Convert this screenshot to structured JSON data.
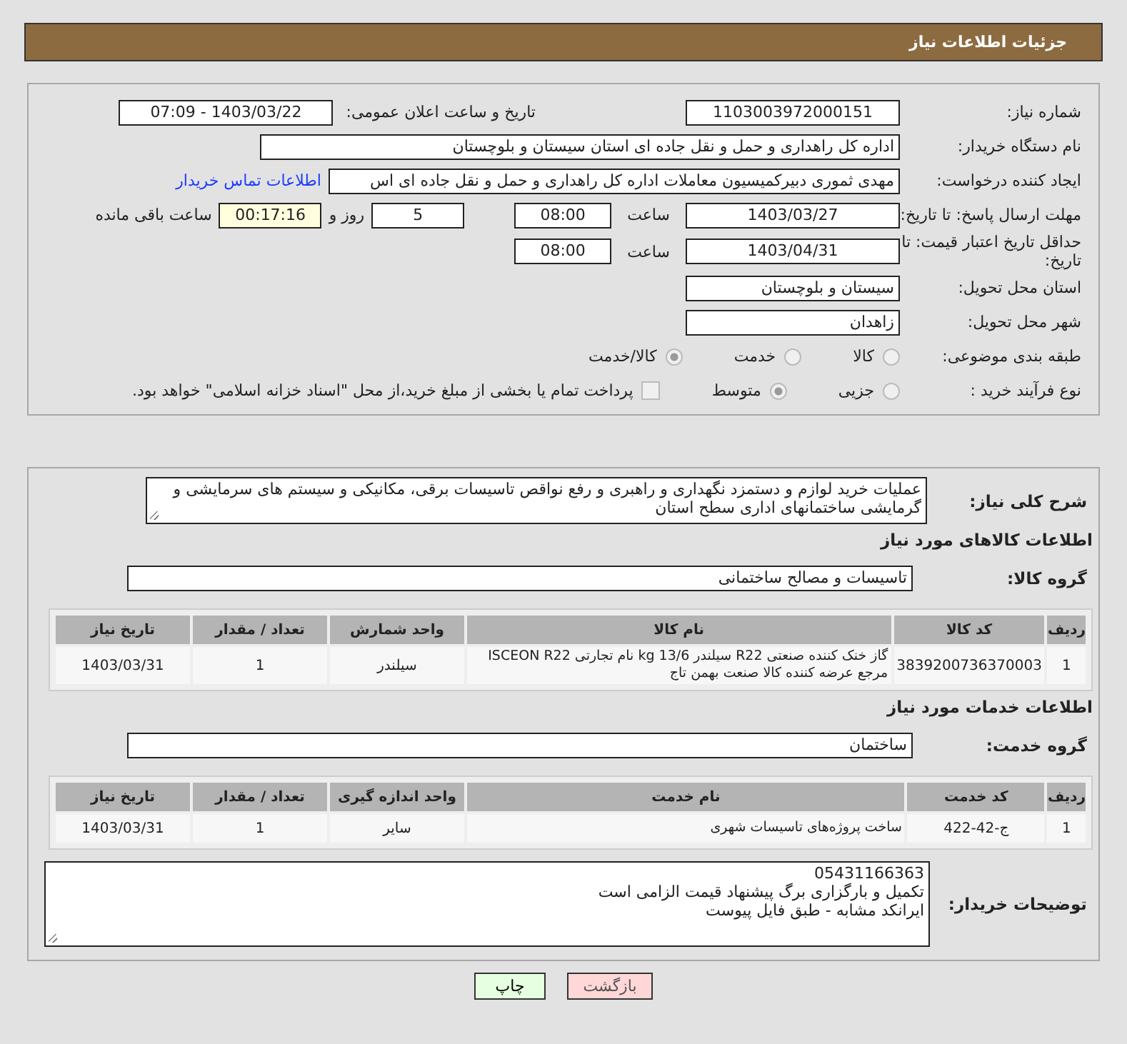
{
  "header": {
    "title": "جزئیات اطلاعات نیاز"
  },
  "need_number": {
    "label": "شماره نیاز:",
    "value": "1103003972000151"
  },
  "announce": {
    "label": "تاریخ و ساعت اعلان عمومی:",
    "value": "1403/03/22 - 07:09"
  },
  "buyer_org": {
    "label": "نام دستگاه خریدار:",
    "value": "اداره کل راهداری و حمل و نقل جاده ای استان سیستان و بلوچستان"
  },
  "requester": {
    "label": "ایجاد کننده درخواست:",
    "value": "مهدی ثموری دبیرکمیسیون معاملات اداره کل راهداری و حمل و نقل جاده ای اس",
    "link": "اطلاعات تماس خریدار"
  },
  "reply_deadline": {
    "label": "مهلت ارسال پاسخ: تا تاریخ:",
    "date": "1403/03/27",
    "time_label": "ساعت",
    "time": "08:00",
    "days": "5",
    "days_label": "روز و",
    "remaining": "00:17:16",
    "remaining_label": "ساعت باقی مانده"
  },
  "validity": {
    "label": "حداقل تاریخ اعتبار قیمت: تا تاریخ:",
    "date": "1403/04/31",
    "time_label": "ساعت",
    "time": "08:00"
  },
  "province": {
    "label": "استان محل تحویل:",
    "value": "سیستان و بلوچستان"
  },
  "city": {
    "label": "شهر محل تحویل:",
    "value": "زاهدان"
  },
  "category": {
    "label": "طبقه بندی موضوعی:",
    "options": [
      {
        "label": "کالا",
        "selected": false
      },
      {
        "label": "خدمت",
        "selected": false
      },
      {
        "label": "کالا/خدمت",
        "selected": true
      }
    ]
  },
  "process": {
    "label": "نوع فرآیند خرید :",
    "options": [
      {
        "label": "جزیی",
        "selected": false
      },
      {
        "label": "متوسط",
        "selected": true
      }
    ],
    "checkbox": {
      "checked": false,
      "label": "پرداخت تمام یا بخشی از مبلغ خرید،از محل \"اسناد خزانه اسلامی\" خواهد بود."
    }
  },
  "description": {
    "label": "شرح کلی نیاز:",
    "value": "عملیات خرید لوازم و دستمزد نگهداری و راهبری و رفع نواقص تاسیسات برقی، مکانیکی و سیستم های سرمایشی و گرمایشی ساختمانهای اداری سطح استان"
  },
  "goods": {
    "title": "اطلاعات کالاهای مورد نیاز",
    "group_label": "گروه کالا:",
    "group_value": "تاسیسات و مصالح ساختمانی",
    "columns": [
      "ردیف",
      "کد کالا",
      "نام کالا",
      "واحد شمارش",
      "تعداد / مقدار",
      "تاریخ نیاز"
    ],
    "rows": [
      [
        "1",
        "3839200736370003",
        "گاز خنک کننده صنعتی R22 سیلندر 13/6 kg نام تجارتی ISCEON R22 مرجع عرضه کننده کالا صنعت بهمن تاج",
        "سیلندر",
        "1",
        "1403/03/31"
      ]
    ]
  },
  "services": {
    "title": "اطلاعات خدمات مورد نیاز",
    "group_label": "گروه خدمت:",
    "group_value": "ساختمان",
    "columns": [
      "ردیف",
      "کد خدمت",
      "نام خدمت",
      "واحد اندازه گیری",
      "تعداد / مقدار",
      "تاریخ نیاز"
    ],
    "rows": [
      [
        "1",
        "ج-42-422",
        "ساخت پروژه‌های تاسیسات شهری",
        "سایر",
        "1",
        "1403/03/31"
      ]
    ]
  },
  "buyer_notes": {
    "label": "توضیحات خریدار:",
    "lines": [
      "05431166363",
      "تکمیل و بارگزاری برگ پیشنهاد قیمت الزامی است",
      "ایرانکد مشابه - طبق فایل پیوست"
    ]
  },
  "buttons": [
    {
      "label": "بازگشت",
      "kind": "back"
    },
    {
      "label": "چاپ",
      "kind": "print"
    }
  ]
}
